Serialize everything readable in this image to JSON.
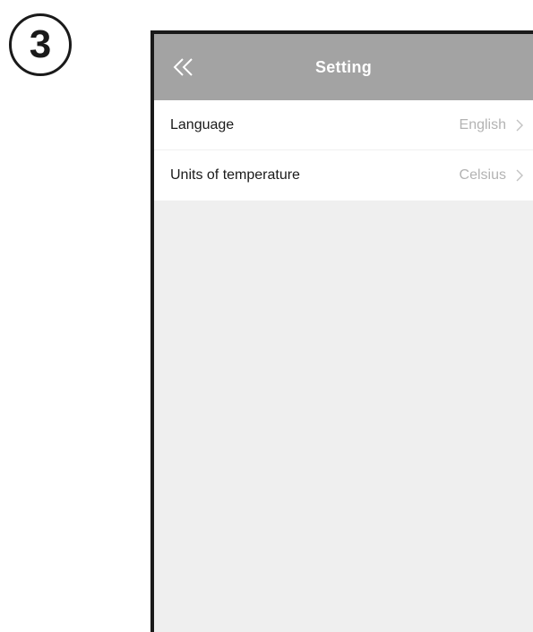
{
  "step": {
    "number": "3"
  },
  "nav": {
    "title": "Setting",
    "back_icon": "double-chevron-left-icon"
  },
  "settings": {
    "items": [
      {
        "label": "Language",
        "value": "English"
      },
      {
        "label": "Units of temperature",
        "value": "Celsius"
      }
    ]
  },
  "colors": {
    "nav_background": "#a3a3a3",
    "screen_background": "#efefef",
    "row_background": "#ffffff",
    "label_text": "#1a1a1a",
    "value_text": "#b3b3b3"
  }
}
